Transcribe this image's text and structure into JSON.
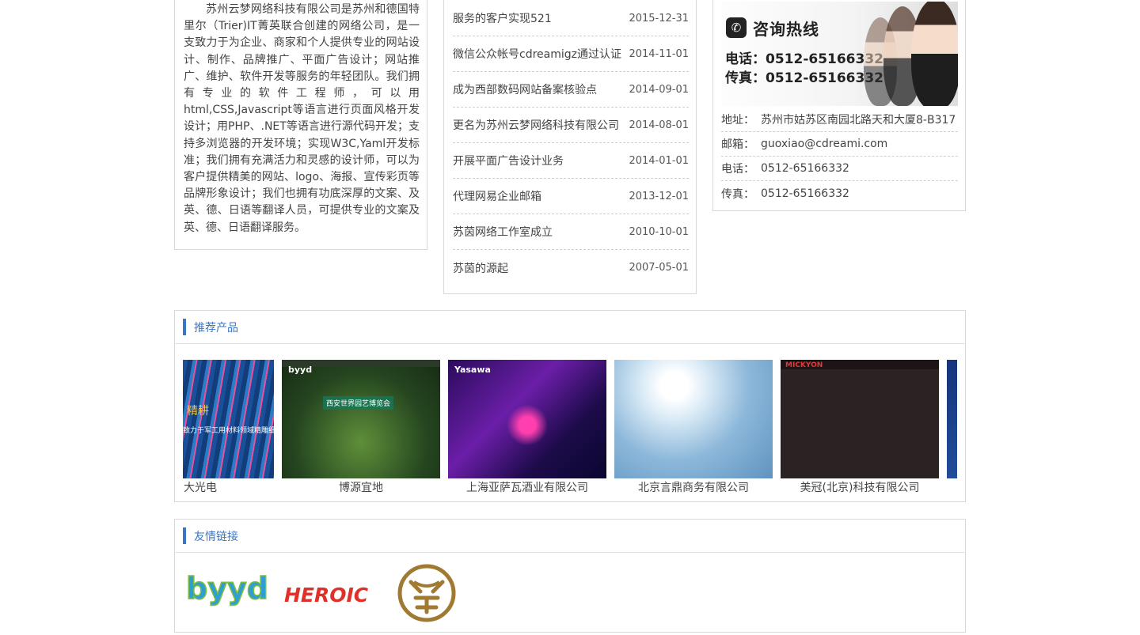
{
  "about": {
    "text": "苏州云梦网络科技有限公司是苏州和德国特里尔（Trier)IT菁英联合创建的网络公司，是一支致力于为企业、商家和个人提供专业的网站设计、制作、品牌推广、平面广告设计；网站推广、维护、软件开发等服务的年轻团队。我们拥有专业的软件工程师，可以用html,CSS,Javascript等语言进行页面风格开发设计；用PHP、.NET等语言进行源代码开发；支持多浏览器的开发环境；实现W3C,Yaml开发标准；我们拥有充满活力和灵感的设计师，可以为客户提供精美的网站、logo、海报、宣传彩页等品牌形象设计；我们也拥有功底深厚的文案、及英、德、日语等翻译人员，可提供专业的文案及英、德、日语翻译服务。"
  },
  "news": [
    {
      "title": "服务的客户实现521",
      "date": "2015-12-31"
    },
    {
      "title": "微信公众帐号cdreamigz通过认证",
      "date": "2014-11-01"
    },
    {
      "title": "成为西部数码网站备案核验点",
      "date": "2014-09-01"
    },
    {
      "title": "更名为苏州云梦网络科技有限公司",
      "date": "2014-08-01"
    },
    {
      "title": "开展平面广告设计业务",
      "date": "2014-01-01"
    },
    {
      "title": "代理网易企业邮箱",
      "date": "2013-12-01"
    },
    {
      "title": "苏茵网络工作室成立",
      "date": "2010-10-01"
    },
    {
      "title": "苏茵的源起",
      "date": "2007-05-01"
    }
  ],
  "contact": {
    "hotline_title": "咨询热线",
    "hotline_tel": "电话：0512-65166332",
    "hotline_fax": "传真：0512-65166332",
    "rows": [
      {
        "label": "地址：",
        "value": "苏州市姑苏区南园北路天和大厦8-B317"
      },
      {
        "label": "邮箱：",
        "value": "guoxiao@cdreami.com"
      },
      {
        "label": "电话：",
        "value": "0512-65166332"
      },
      {
        "label": "传真：",
        "value": "0512-65166332"
      }
    ]
  },
  "products": {
    "title": "推荐产品",
    "items": [
      {
        "name": "大光电",
        "thumb_text": "精耕",
        "thumb_sub": "致力于军工用材料领域精雕细琢"
      },
      {
        "name": "博源宜地",
        "thumb_text": "byyd",
        "thumb_sub": "西安世界园艺博览会"
      },
      {
        "name": "上海亚萨瓦酒业有限公司",
        "thumb_text": "Yasawa",
        "thumb_sub": ""
      },
      {
        "name": "北京言鼎商务有限公司",
        "thumb_text": "",
        "thumb_sub": ""
      },
      {
        "name": "美冠(北京)科技有限公司",
        "thumb_text": "MICKYON",
        "thumb_sub": ""
      },
      {
        "name": "",
        "thumb_text": "",
        "thumb_sub": ""
      }
    ]
  },
  "links": {
    "title": "友情链接",
    "logos": [
      {
        "text": "byyd"
      },
      {
        "text": "HEROIC"
      },
      {
        "text": ""
      }
    ]
  },
  "colors": {
    "accent": "#3a76c6",
    "border": "#d9d9d9",
    "text": "#444444"
  },
  "icons": {
    "hotline": "phone-icon",
    "section_marker": "blue-bar"
  }
}
